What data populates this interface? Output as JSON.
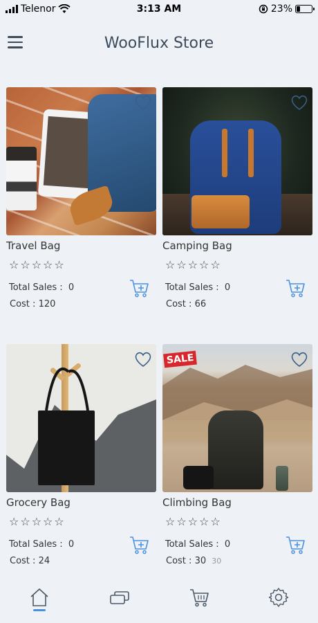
{
  "status_bar": {
    "carrier": "Telenor",
    "time": "3:13 AM",
    "battery": "23%",
    "battery_level": 0.23
  },
  "app_bar": {
    "title": "WooFlux Store",
    "menu_icon": "hamburger-menu-icon"
  },
  "products": [
    {
      "name": "Travel Bag",
      "sales_label": "Total Sales :",
      "sales_value": "0",
      "cost_label": "Cost :",
      "cost_value": "120",
      "rating": 0,
      "max_rating": 5
    },
    {
      "name": "Camping Bag",
      "sales_label": "Total Sales :",
      "sales_value": "0",
      "cost_label": "Cost :",
      "cost_value": "66",
      "rating": 0,
      "max_rating": 5
    },
    {
      "name": "Grocery Bag",
      "sales_label": "Total Sales :",
      "sales_value": "0",
      "cost_label": "Cost :",
      "cost_value": "24",
      "rating": 0,
      "max_rating": 5
    },
    {
      "name": "Climbing Bag",
      "sales_label": "Total Sales :",
      "sales_value": "0",
      "cost_label": "Cost :",
      "cost_value": "30",
      "old_cost": "30",
      "sale_badge": "SALE",
      "rating": 0,
      "max_rating": 5
    }
  ],
  "bottom_nav": {
    "items": [
      "home-icon",
      "cards-icon",
      "cart-icon",
      "settings-icon"
    ],
    "active": "home-icon"
  },
  "colors": {
    "background": "#eef2f7",
    "accent": "#4a90e2",
    "title": "#3c4a5a",
    "sale": "#d8262d"
  }
}
